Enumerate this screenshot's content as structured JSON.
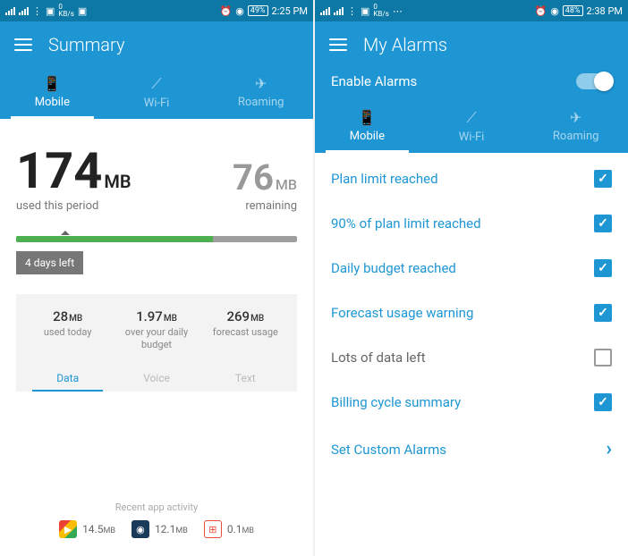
{
  "left": {
    "status": {
      "kbs": "0",
      "kbs_unit": "KB/s",
      "battery": "49%",
      "time": "2:25 PM"
    },
    "title": "Summary",
    "tabs": [
      "Mobile",
      "Wi-Fi",
      "Roaming"
    ],
    "active_tab": 0,
    "used": {
      "value": "174",
      "unit": "MB",
      "label": "used this period"
    },
    "remaining": {
      "value": "76",
      "unit": "MB",
      "label": "remaining"
    },
    "progress_pct": 70,
    "days_left": "4 days left",
    "stats": [
      {
        "value": "28",
        "unit": "MB",
        "label": "used today"
      },
      {
        "value": "1.97",
        "unit": "MB",
        "label": "over your daily budget"
      },
      {
        "value": "269",
        "unit": "MB",
        "label": "forecast usage"
      }
    ],
    "stats_tabs": [
      "Data",
      "Voice",
      "Text"
    ],
    "stats_active_tab": 0,
    "recent_title": "Recent app activity",
    "recent_apps": [
      {
        "name": "play",
        "value": "14.5",
        "unit": "MB",
        "color": "#fff"
      },
      {
        "name": "app2",
        "value": "12.1",
        "unit": "MB",
        "color": "#1a3a5a"
      },
      {
        "name": "app3",
        "value": "0.1",
        "unit": "MB",
        "color": "#e74c3c"
      }
    ]
  },
  "right": {
    "status": {
      "kbs": "0",
      "kbs_unit": "KB/s",
      "battery": "48%",
      "time": "2:38 PM"
    },
    "title": "My Alarms",
    "enable_label": "Enable Alarms",
    "enable_on": true,
    "tabs": [
      "Mobile",
      "Wi-Fi",
      "Roaming"
    ],
    "active_tab": 0,
    "alarms": [
      {
        "label": "Plan limit reached",
        "checked": true
      },
      {
        "label": "90% of plan limit reached",
        "checked": true
      },
      {
        "label": "Daily budget reached",
        "checked": true
      },
      {
        "label": "Forecast usage warning",
        "checked": true
      },
      {
        "label": "Lots of data left",
        "checked": false
      },
      {
        "label": "Billing cycle summary",
        "checked": true
      }
    ],
    "custom_label": "Set Custom Alarms"
  }
}
